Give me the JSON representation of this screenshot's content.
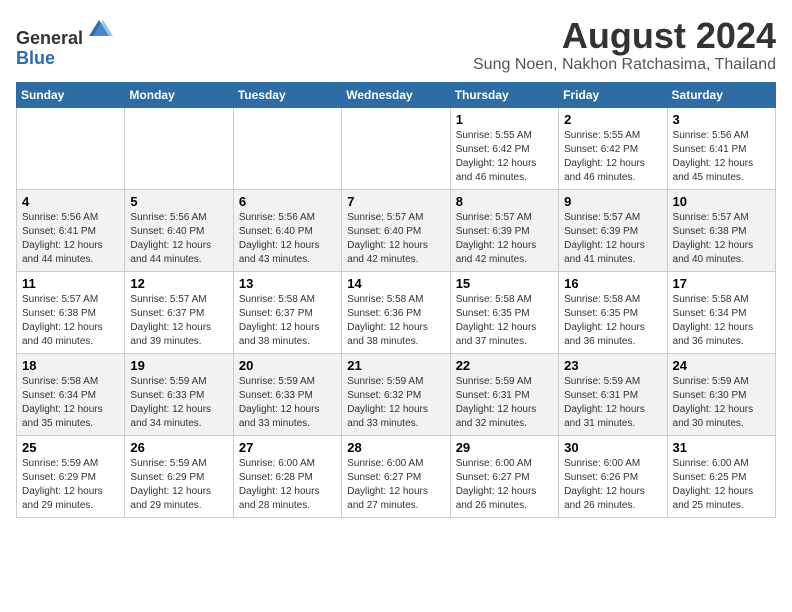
{
  "header": {
    "logo_line1": "General",
    "logo_line2": "Blue",
    "month_title": "August 2024",
    "subtitle": "Sung Noen, Nakhon Ratchasima, Thailand"
  },
  "calendar": {
    "weekdays": [
      "Sunday",
      "Monday",
      "Tuesday",
      "Wednesday",
      "Thursday",
      "Friday",
      "Saturday"
    ],
    "weeks": [
      [
        {
          "day": "",
          "info": ""
        },
        {
          "day": "",
          "info": ""
        },
        {
          "day": "",
          "info": ""
        },
        {
          "day": "",
          "info": ""
        },
        {
          "day": "1",
          "info": "Sunrise: 5:55 AM\nSunset: 6:42 PM\nDaylight: 12 hours\nand 46 minutes."
        },
        {
          "day": "2",
          "info": "Sunrise: 5:55 AM\nSunset: 6:42 PM\nDaylight: 12 hours\nand 46 minutes."
        },
        {
          "day": "3",
          "info": "Sunrise: 5:56 AM\nSunset: 6:41 PM\nDaylight: 12 hours\nand 45 minutes."
        }
      ],
      [
        {
          "day": "4",
          "info": "Sunrise: 5:56 AM\nSunset: 6:41 PM\nDaylight: 12 hours\nand 44 minutes."
        },
        {
          "day": "5",
          "info": "Sunrise: 5:56 AM\nSunset: 6:40 PM\nDaylight: 12 hours\nand 44 minutes."
        },
        {
          "day": "6",
          "info": "Sunrise: 5:56 AM\nSunset: 6:40 PM\nDaylight: 12 hours\nand 43 minutes."
        },
        {
          "day": "7",
          "info": "Sunrise: 5:57 AM\nSunset: 6:40 PM\nDaylight: 12 hours\nand 42 minutes."
        },
        {
          "day": "8",
          "info": "Sunrise: 5:57 AM\nSunset: 6:39 PM\nDaylight: 12 hours\nand 42 minutes."
        },
        {
          "day": "9",
          "info": "Sunrise: 5:57 AM\nSunset: 6:39 PM\nDaylight: 12 hours\nand 41 minutes."
        },
        {
          "day": "10",
          "info": "Sunrise: 5:57 AM\nSunset: 6:38 PM\nDaylight: 12 hours\nand 40 minutes."
        }
      ],
      [
        {
          "day": "11",
          "info": "Sunrise: 5:57 AM\nSunset: 6:38 PM\nDaylight: 12 hours\nand 40 minutes."
        },
        {
          "day": "12",
          "info": "Sunrise: 5:57 AM\nSunset: 6:37 PM\nDaylight: 12 hours\nand 39 minutes."
        },
        {
          "day": "13",
          "info": "Sunrise: 5:58 AM\nSunset: 6:37 PM\nDaylight: 12 hours\nand 38 minutes."
        },
        {
          "day": "14",
          "info": "Sunrise: 5:58 AM\nSunset: 6:36 PM\nDaylight: 12 hours\nand 38 minutes."
        },
        {
          "day": "15",
          "info": "Sunrise: 5:58 AM\nSunset: 6:35 PM\nDaylight: 12 hours\nand 37 minutes."
        },
        {
          "day": "16",
          "info": "Sunrise: 5:58 AM\nSunset: 6:35 PM\nDaylight: 12 hours\nand 36 minutes."
        },
        {
          "day": "17",
          "info": "Sunrise: 5:58 AM\nSunset: 6:34 PM\nDaylight: 12 hours\nand 36 minutes."
        }
      ],
      [
        {
          "day": "18",
          "info": "Sunrise: 5:58 AM\nSunset: 6:34 PM\nDaylight: 12 hours\nand 35 minutes."
        },
        {
          "day": "19",
          "info": "Sunrise: 5:59 AM\nSunset: 6:33 PM\nDaylight: 12 hours\nand 34 minutes."
        },
        {
          "day": "20",
          "info": "Sunrise: 5:59 AM\nSunset: 6:33 PM\nDaylight: 12 hours\nand 33 minutes."
        },
        {
          "day": "21",
          "info": "Sunrise: 5:59 AM\nSunset: 6:32 PM\nDaylight: 12 hours\nand 33 minutes."
        },
        {
          "day": "22",
          "info": "Sunrise: 5:59 AM\nSunset: 6:31 PM\nDaylight: 12 hours\nand 32 minutes."
        },
        {
          "day": "23",
          "info": "Sunrise: 5:59 AM\nSunset: 6:31 PM\nDaylight: 12 hours\nand 31 minutes."
        },
        {
          "day": "24",
          "info": "Sunrise: 5:59 AM\nSunset: 6:30 PM\nDaylight: 12 hours\nand 30 minutes."
        }
      ],
      [
        {
          "day": "25",
          "info": "Sunrise: 5:59 AM\nSunset: 6:29 PM\nDaylight: 12 hours\nand 29 minutes."
        },
        {
          "day": "26",
          "info": "Sunrise: 5:59 AM\nSunset: 6:29 PM\nDaylight: 12 hours\nand 29 minutes."
        },
        {
          "day": "27",
          "info": "Sunrise: 6:00 AM\nSunset: 6:28 PM\nDaylight: 12 hours\nand 28 minutes."
        },
        {
          "day": "28",
          "info": "Sunrise: 6:00 AM\nSunset: 6:27 PM\nDaylight: 12 hours\nand 27 minutes."
        },
        {
          "day": "29",
          "info": "Sunrise: 6:00 AM\nSunset: 6:27 PM\nDaylight: 12 hours\nand 26 minutes."
        },
        {
          "day": "30",
          "info": "Sunrise: 6:00 AM\nSunset: 6:26 PM\nDaylight: 12 hours\nand 26 minutes."
        },
        {
          "day": "31",
          "info": "Sunrise: 6:00 AM\nSunset: 6:25 PM\nDaylight: 12 hours\nand 25 minutes."
        }
      ]
    ]
  }
}
